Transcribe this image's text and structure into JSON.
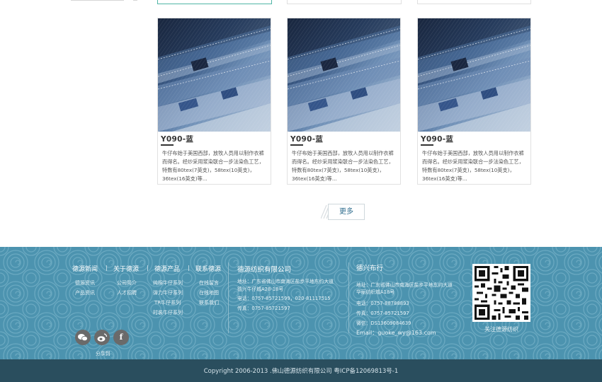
{
  "products": [
    {
      "title": "Y090-蓝",
      "description": "牛仔布始于美国西部，放牧人员用以制作衣裤而得名。经纱采用浆染联合一步法染色工艺，特数有80tex(7英支)，58tex(10英支)，36tex(16英支)等..."
    },
    {
      "title": "Y090-蓝",
      "description": "牛仔布始于美国西部，放牧人员用以制作衣裤而得名。经纱采用浆染联合一步法染色工艺，特数有80tex(7英支)，58tex(10英支)，36tex(16英支)等..."
    },
    {
      "title": "Y090-蓝",
      "description": "牛仔布始于美国西部，放牧人员用以制作衣裤而得名。经纱采用浆染联合一步法染色工艺，特数有80tex(7英支)，58tex(10英支)，36tex(16英支)等..."
    }
  ],
  "more_label": "更多",
  "footer": {
    "nav": [
      {
        "label": "德源新闻",
        "subs": [
          "德源资讯",
          "产品资讯"
        ]
      },
      {
        "label": "关于德源",
        "subs": [
          "公司简介",
          "人才招聘"
        ]
      },
      {
        "label": "德源产品",
        "subs": [
          "纯棉牛仔系列",
          "弹力牛仔系列",
          "TR牛仔系列",
          "时装牛仔系列"
        ]
      },
      {
        "label": "联系德源",
        "subs": [
          "在线留言",
          "在线地图",
          "联系我们"
        ]
      }
    ],
    "company": {
      "name": "德源纺织有限公司",
      "lines": [
        "地址：广东省佛山市南海区盐步平地东约大道",
        "德兴牛仔城A28-18号",
        "电话：0757-85721599，020-81117515",
        "传真：0757-85721597"
      ]
    },
    "shop": {
      "name": "德兴布行",
      "lines": [
        "地址：广东省佛山市南海区盐步平地东约大道",
        "华丽纺织城A18号",
        "电话：0757-88788893",
        "传真：0757-85721597",
        "微信：DS13609084639",
        "Email：guoke_wy@163.com"
      ]
    },
    "qr_label": "关注德源纺织",
    "share_label": "分享到",
    "copyright": "Copyright 2006-2013 .佛山德源纺织有限公司   粤ICP备12069813号-1"
  },
  "colors": {
    "footer_bg": "#4c93af",
    "footer_bottom": "#2a4e5e",
    "more_text": "#2f6d8e",
    "active_border": "#4fb5a6"
  },
  "icons": [
    "wechat-icon",
    "weibo-icon",
    "facebook-icon"
  ]
}
